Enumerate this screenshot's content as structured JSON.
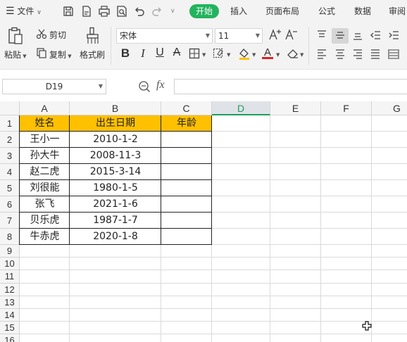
{
  "menubar": {
    "menu_label": "文件",
    "tabs": {
      "start": "开始",
      "insert": "插入",
      "page_layout": "页面布局",
      "formula": "公式",
      "data": "数据",
      "review": "审阅"
    }
  },
  "ribbon": {
    "cut": "剪切",
    "paste": "粘贴",
    "copy": "复制",
    "format_painter": "格式刷",
    "font_name": "宋体",
    "font_size": "11"
  },
  "formula_bar": {
    "name_box": "D19",
    "fx": "fx",
    "content": ""
  },
  "sheet": {
    "columns": [
      "A",
      "B",
      "C",
      "D",
      "E",
      "F",
      "G"
    ],
    "rows": [
      "1",
      "2",
      "3",
      "4",
      "5",
      "6",
      "7",
      "8",
      "9",
      "10",
      "11",
      "12",
      "13",
      "14",
      "15",
      "16"
    ],
    "header_row": [
      "姓名",
      "出生日期",
      "年龄"
    ],
    "data_rows": [
      [
        "王小一",
        "2010-1-2",
        ""
      ],
      [
        "孙大牛",
        "2008-11-3",
        ""
      ],
      [
        "赵二虎",
        "2015-3-14",
        ""
      ],
      [
        "刘很能",
        "1980-1-5",
        ""
      ],
      [
        "张飞",
        "2021-1-6",
        ""
      ],
      [
        "贝乐虎",
        "1987-1-7",
        ""
      ],
      [
        "牛赤虎",
        "2020-1-8",
        ""
      ]
    ],
    "selected_column": "D"
  },
  "colors": {
    "accent": "#22b35e",
    "header_fill": "#ffc000",
    "selected_header_text": "#1f9e5a"
  }
}
